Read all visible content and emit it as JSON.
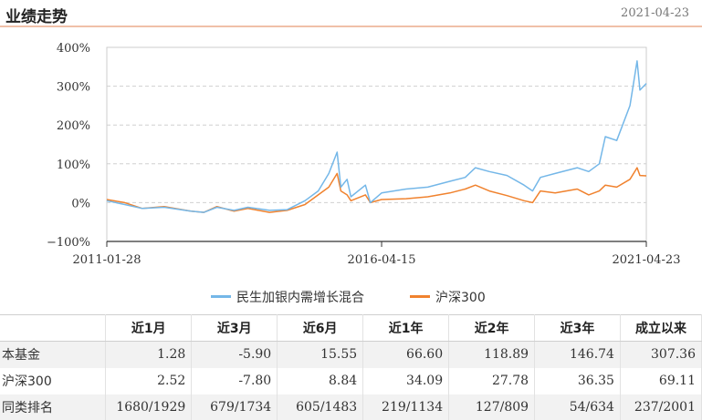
{
  "header": {
    "title": "业绩走势",
    "date": "2021-04-23"
  },
  "legend": {
    "fund_label": "民生加银内需增长混合",
    "index_label": "沪深300"
  },
  "colors": {
    "fund": "#74b7e8",
    "index": "#f0822e",
    "accent_border": "#f0c0a8"
  },
  "table": {
    "headers": [
      "",
      "近1月",
      "近3月",
      "近6月",
      "近1年",
      "近2年",
      "近3年",
      "成立以来"
    ],
    "rows": [
      {
        "label": "本基金",
        "values": [
          "1.28",
          "-5.90",
          "15.55",
          "66.60",
          "118.89",
          "146.74",
          "307.36"
        ]
      },
      {
        "label": "沪深300",
        "values": [
          "2.52",
          "-7.80",
          "8.84",
          "34.09",
          "27.78",
          "36.35",
          "69.11"
        ]
      },
      {
        "label": "同类排名",
        "values": [
          "1680/1929",
          "679/1734",
          "605/1483",
          "219/1134",
          "127/809",
          "54/634",
          "237/2001"
        ]
      }
    ]
  },
  "chart_data": {
    "type": "line",
    "title": "",
    "xlabel": "",
    "ylabel": "",
    "x_ticks": [
      "2011-01-28",
      "2016-04-15",
      "2021-04-23"
    ],
    "y_ticks": [
      "400%",
      "300%",
      "200%",
      "100%",
      "0%",
      "−100%"
    ],
    "ylim": [
      -100,
      400
    ],
    "grid": "horizontal dashed",
    "legend_position": "bottom",
    "series": [
      {
        "name": "民生加银内需增长混合",
        "color": "#74b7e8",
        "points": [
          [
            "2011-01-28",
            5
          ],
          [
            "2011-06-01",
            -5
          ],
          [
            "2011-10-01",
            -15
          ],
          [
            "2012-03-01",
            -12
          ],
          [
            "2012-09-01",
            -22
          ],
          [
            "2012-12-01",
            -25
          ],
          [
            "2013-03-01",
            -12
          ],
          [
            "2013-06-28",
            -20
          ],
          [
            "2013-10-01",
            -12
          ],
          [
            "2014-03-01",
            -20
          ],
          [
            "2014-07-01",
            -18
          ],
          [
            "2014-11-01",
            5
          ],
          [
            "2015-02-01",
            30
          ],
          [
            "2015-04-15",
            75
          ],
          [
            "2015-06-12",
            130
          ],
          [
            "2015-07-08",
            40
          ],
          [
            "2015-08-20",
            60
          ],
          [
            "2015-09-15",
            15
          ],
          [
            "2015-12-25",
            45
          ],
          [
            "2016-01-28",
            0
          ],
          [
            "2016-04-15",
            25
          ],
          [
            "2016-10-01",
            35
          ],
          [
            "2017-03-01",
            40
          ],
          [
            "2017-08-01",
            55
          ],
          [
            "2017-11-15",
            65
          ],
          [
            "2018-01-25",
            90
          ],
          [
            "2018-05-01",
            80
          ],
          [
            "2018-09-01",
            70
          ],
          [
            "2018-12-28",
            45
          ],
          [
            "2019-02-25",
            30
          ],
          [
            "2019-04-20",
            65
          ],
          [
            "2019-08-01",
            75
          ],
          [
            "2019-12-31",
            90
          ],
          [
            "2020-03-20",
            80
          ],
          [
            "2020-06-01",
            100
          ],
          [
            "2020-07-13",
            170
          ],
          [
            "2020-09-30",
            160
          ],
          [
            "2020-12-31",
            250
          ],
          [
            "2021-02-18",
            365
          ],
          [
            "2021-03-10",
            290
          ],
          [
            "2021-04-23",
            307
          ]
        ]
      },
      {
        "name": "沪深300",
        "color": "#f0822e",
        "points": [
          [
            "2011-01-28",
            8
          ],
          [
            "2011-06-01",
            0
          ],
          [
            "2011-10-01",
            -15
          ],
          [
            "2012-03-01",
            -10
          ],
          [
            "2012-09-01",
            -22
          ],
          [
            "2012-12-01",
            -25
          ],
          [
            "2013-03-01",
            -10
          ],
          [
            "2013-06-28",
            -22
          ],
          [
            "2013-10-01",
            -15
          ],
          [
            "2014-03-01",
            -25
          ],
          [
            "2014-07-01",
            -20
          ],
          [
            "2014-11-01",
            -5
          ],
          [
            "2015-02-01",
            20
          ],
          [
            "2015-04-15",
            40
          ],
          [
            "2015-06-12",
            75
          ],
          [
            "2015-07-08",
            30
          ],
          [
            "2015-08-20",
            20
          ],
          [
            "2015-09-15",
            5
          ],
          [
            "2015-12-25",
            20
          ],
          [
            "2016-01-28",
            0
          ],
          [
            "2016-04-15",
            8
          ],
          [
            "2016-10-01",
            10
          ],
          [
            "2017-03-01",
            15
          ],
          [
            "2017-08-01",
            25
          ],
          [
            "2017-11-15",
            35
          ],
          [
            "2018-01-25",
            45
          ],
          [
            "2018-05-01",
            30
          ],
          [
            "2018-09-01",
            18
          ],
          [
            "2018-12-28",
            5
          ],
          [
            "2019-02-25",
            0
          ],
          [
            "2019-04-20",
            30
          ],
          [
            "2019-08-01",
            25
          ],
          [
            "2019-12-31",
            35
          ],
          [
            "2020-03-20",
            20
          ],
          [
            "2020-06-01",
            30
          ],
          [
            "2020-07-13",
            45
          ],
          [
            "2020-09-30",
            40
          ],
          [
            "2020-12-31",
            60
          ],
          [
            "2021-02-18",
            90
          ],
          [
            "2021-03-10",
            70
          ],
          [
            "2021-04-23",
            69
          ]
        ]
      }
    ]
  }
}
